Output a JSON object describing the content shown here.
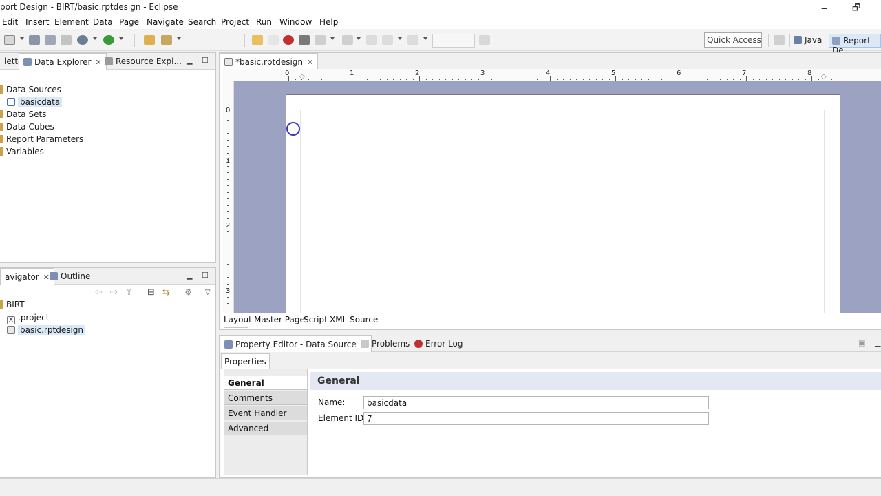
{
  "window": {
    "title": "port Design - BIRT/basic.rptdesign - Eclipse",
    "minimize": "🗕",
    "restore": "🗗"
  },
  "menu": [
    "Edit",
    "Insert",
    "Element",
    "Data",
    "Page",
    "Navigate",
    "Search",
    "Project",
    "Run",
    "Window",
    "Help"
  ],
  "toolbar": {
    "quick_access": "Quick Access",
    "perspectives": [
      "Java",
      "Report De"
    ]
  },
  "data_explorer": {
    "tabs": [
      "lette",
      "Data Explorer",
      "Resource Expl..."
    ],
    "tree": [
      {
        "label": "Data Sources",
        "level": 0
      },
      {
        "label": "basicdata",
        "level": 1,
        "selected": true
      },
      {
        "label": "Data Sets",
        "level": 0
      },
      {
        "label": "Data Cubes",
        "level": 0
      },
      {
        "label": "Report Parameters",
        "level": 0
      },
      {
        "label": "Variables",
        "level": 0
      }
    ]
  },
  "navigator": {
    "tabs": [
      "avigator",
      "Outline"
    ],
    "tree": [
      {
        "label": "BIRT",
        "level": 0
      },
      {
        "label": ".project",
        "level": 1
      },
      {
        "label": "basic.rptdesign",
        "level": 1,
        "selected": true
      }
    ]
  },
  "editor": {
    "tab": "*basic.rptdesign",
    "ruler_top_numbers": [
      "1",
      "2",
      "3",
      "4",
      "5",
      "6",
      "7",
      "8"
    ],
    "ruler_left_numbers": [
      "1",
      "2",
      "3"
    ],
    "bottom_tabs": [
      "Layout",
      "Master Page",
      "Script",
      "XML Source"
    ]
  },
  "property_panel": {
    "tabs": [
      "Property Editor - Data Source",
      "Problems",
      "Error Log"
    ],
    "subtab": "Properties",
    "categories": [
      "General",
      "Comments",
      "Event Handler",
      "Advanced"
    ],
    "section_title": "General",
    "fields": [
      {
        "label": "Name:",
        "value": "basicdata"
      },
      {
        "label": "Element ID:",
        "value": "7"
      }
    ]
  },
  "colors": {
    "canvas_bg": "#9ca3c2",
    "selection": "#dbe8f7",
    "cursor_ring": "#3a3ab8"
  }
}
